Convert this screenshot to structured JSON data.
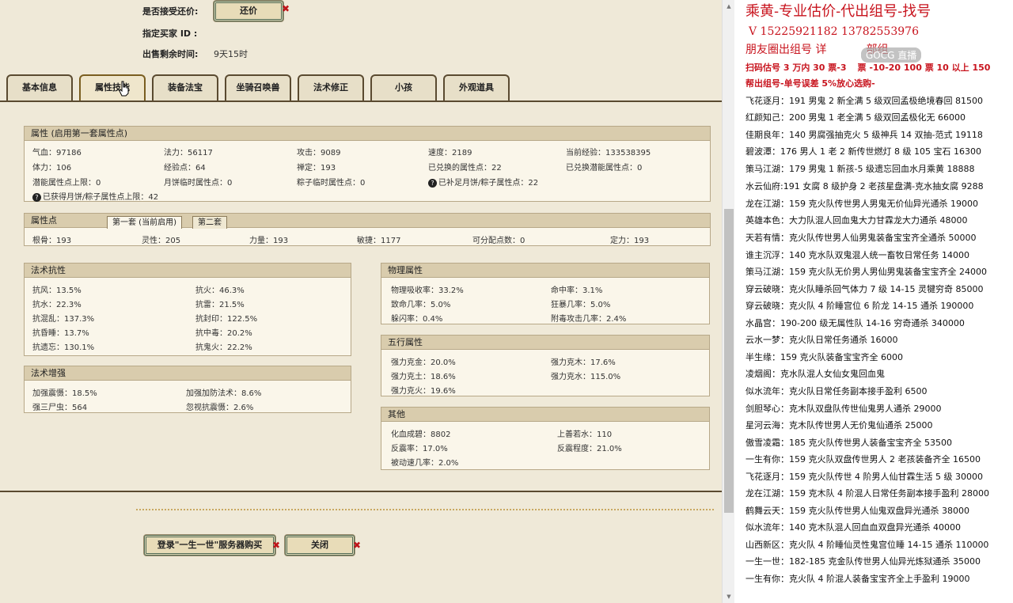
{
  "header": {
    "accept_counter_label": "是否接受还价:",
    "counter_button": "还价",
    "buyer_id_label": "指定买家 ID :",
    "time_left_label": "出售剩余时间:",
    "time_left_value": "9天15时"
  },
  "tabs": [
    "基本信息",
    "属性技能",
    "装备法宝",
    "坐骑召唤兽",
    "法术修正",
    "小孩",
    "外观道具"
  ],
  "attributes": {
    "title": "属性 (启用第一套属性点)",
    "rows": [
      [
        "气血：97186",
        "法力：56117",
        "攻击：9089",
        "速度：2189",
        "当前经验：133538395"
      ],
      [
        "体力：106",
        "经验点：64",
        "禅定：193",
        "已兑换的属性点：22",
        "已兑换潜能属性点：0"
      ],
      [
        "潜能属性点上限：0",
        "月饼临时属性点：0",
        "粽子临时属性点：0",
        "已补足月饼/粽子属性点：22",
        ""
      ],
      [
        "已获得月饼/粽子属性点上限：42",
        "",
        "",
        "",
        ""
      ]
    ]
  },
  "points": {
    "title": "属性点",
    "subtab1": "第一套 (当前启用)",
    "subtab2": "第二套",
    "row": [
      "根骨：193",
      "灵性：205",
      "力量：193",
      "敏捷：1177",
      "可分配点数：0",
      "定力：193"
    ]
  },
  "resist": {
    "title": "法术抗性",
    "rows": [
      [
        "抗风：13.5%",
        "抗火：46.3%"
      ],
      [
        "抗水：22.3%",
        "抗雷：21.5%"
      ],
      [
        "抗混乱：137.3%",
        "抗封印：122.5%"
      ],
      [
        "抗昏睡：13.7%",
        "抗中毒：20.2%"
      ],
      [
        "抗遗忘：130.1%",
        "抗鬼火：22.2%"
      ]
    ]
  },
  "enhance": {
    "title": "法术增强",
    "rows": [
      [
        "加强震慑：18.5%",
        "加强加防法术：8.6%"
      ],
      [
        "强三尸虫：564",
        "忽视抗震慑：2.6%"
      ]
    ]
  },
  "physical": {
    "title": "物理属性",
    "rows": [
      [
        "物理吸收率：33.2%",
        "命中率：3.1%"
      ],
      [
        "致命几率：5.0%",
        "狂暴几率：5.0%"
      ],
      [
        "躲闪率：0.4%",
        "附毒攻击几率：2.4%"
      ]
    ]
  },
  "elements": {
    "title": "五行属性",
    "rows": [
      [
        "强力克金：20.0%",
        "强力克木：17.6%"
      ],
      [
        "强力克土：18.6%",
        "强力克水：115.0%"
      ],
      [
        "强力克火：19.6%",
        ""
      ]
    ]
  },
  "other": {
    "title": "其他",
    "rows": [
      [
        "化血成碧：8802",
        "上善若水：110"
      ],
      [
        "反震率：17.0%",
        "反震程度：21.0%"
      ],
      [
        "被动速几率：2.0%",
        ""
      ]
    ]
  },
  "footer": {
    "login_button": "登录\"一生一世\"服务器购买",
    "close_button": "关闭"
  },
  "ad": {
    "title": "乘黄-专业估价-代出组号-找号",
    "phones": "V 15225921182   13782553976",
    "moments": "朋友圈出组号   详",
    "moments_tail": "部组",
    "scan": "扫码估号 3 万内 30 票-3",
    "scan_mid": "票 -10-20 100 票  10 以上 150",
    "help": "帮出组号-单号误差 5%放心选购-",
    "watermark": "GOCG 直播",
    "listings": [
      "飞花逐月：191 男鬼 2 新全满 5 级双回孟极绝境春回 81500",
      "红颜知己：200 男鬼 1 老全满 5 级双回孟极化无 66000",
      "佳期良年：140 男腐强抽克火 5 级神兵 14 双抽-范式 19118",
      "碧波潭：176 男人 1 老 2 新传世燃灯 8 级 105 宝石 16300",
      "策马江湖：179 男鬼 1 新孩-5 级遗忘回血水月乘黄 18888",
      "水云仙府:191 女腐 8 级护身 2 老孩星盘满-克水抽女腐 9288",
      "龙在江湖：159 克火队传世男人男鬼无价仙异光通杀 19000",
      "英雄本色：大力队混人回血鬼大力甘霖龙大力通杀 48000",
      "天若有情：克火队传世男人仙男鬼装备宝宝齐全通杀 50000",
      "谁主沉浮：140 克水队双鬼混人统一畜牧日常任务 14000",
      "策马江湖：159 克火队无价男人男仙男鬼装备宝宝齐全 24000",
      "穿云破晓：克火队睡杀回气体力 7 级 14-15 灵犍穷奇 85000",
      "穿云破晓：克火队 4 阶睡宫位 6 阶龙 14-15 通杀 190000",
      "水晶宫：190-200 级无属性队 14-16 穷奇通杀 340000",
      "云水一梦：克火队日常任务通杀 16000",
      "半生缘：159 克火队装备宝宝齐全 6000",
      "凌烟阁：克水队混人女仙女鬼回血鬼",
      "似水流年：克火队日常任务副本接手盈利 6500",
      "剑胆琴心：克木队双盘队传世仙鬼男人通杀 29000",
      "星河云海：克木队传世男人无价鬼仙通杀 25000",
      "傲雪凌霜：185 克火队传世男人装备宝宝齐全 53500",
      "一生有你：159 克火队双盘传世男人 2 老孩装备齐全 16500",
      "飞花逐月：159 克火队传世 4 阶男人仙甘霖生活 5 级 30000",
      "龙在江湖：159 克木队 4 阶混人日常任务副本接手盈利 28000",
      "鹤舞云天：159 克火队传世男人仙鬼双盘异光通杀 38000",
      "似水流年：140 克木队混人回血血双盘异光通杀 40000",
      "山西新区：克火队 4 阶睡仙灵性鬼宫位睡 14-15 通杀 110000",
      "一生一世：182-185 克金队传世男人仙异光炼狱通杀 35000",
      "一生有你：克火队 4 阶混人装备宝宝齐全上手盈利 19000"
    ]
  }
}
